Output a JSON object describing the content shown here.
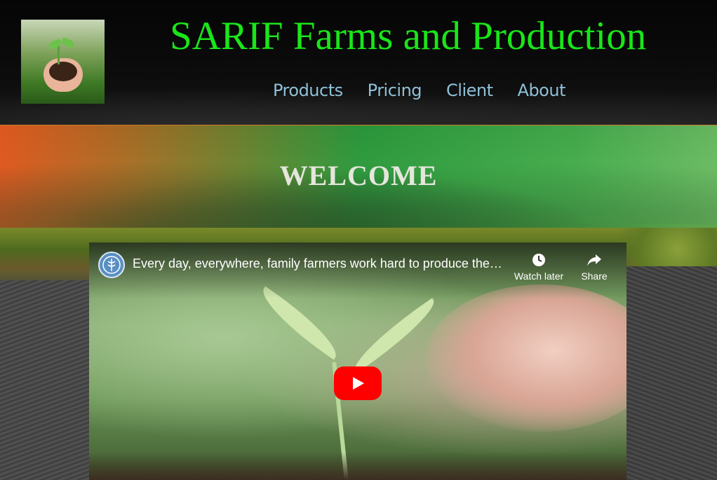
{
  "header": {
    "site_title": "SARIF Farms and Production",
    "nav": [
      {
        "label": "Products"
      },
      {
        "label": "Pricing"
      },
      {
        "label": "Client"
      },
      {
        "label": "About"
      }
    ],
    "title_color": "#19e619",
    "nav_color": "#8fc0d8"
  },
  "banner": {
    "heading": "WELCOME"
  },
  "video": {
    "title": "Every day, everywhere, family farmers work hard to produce the f...",
    "channel_avatar_icon": "fao-logo-icon",
    "watch_later_label": "Watch later",
    "share_label": "Share",
    "play_button_color": "#ff0000"
  }
}
